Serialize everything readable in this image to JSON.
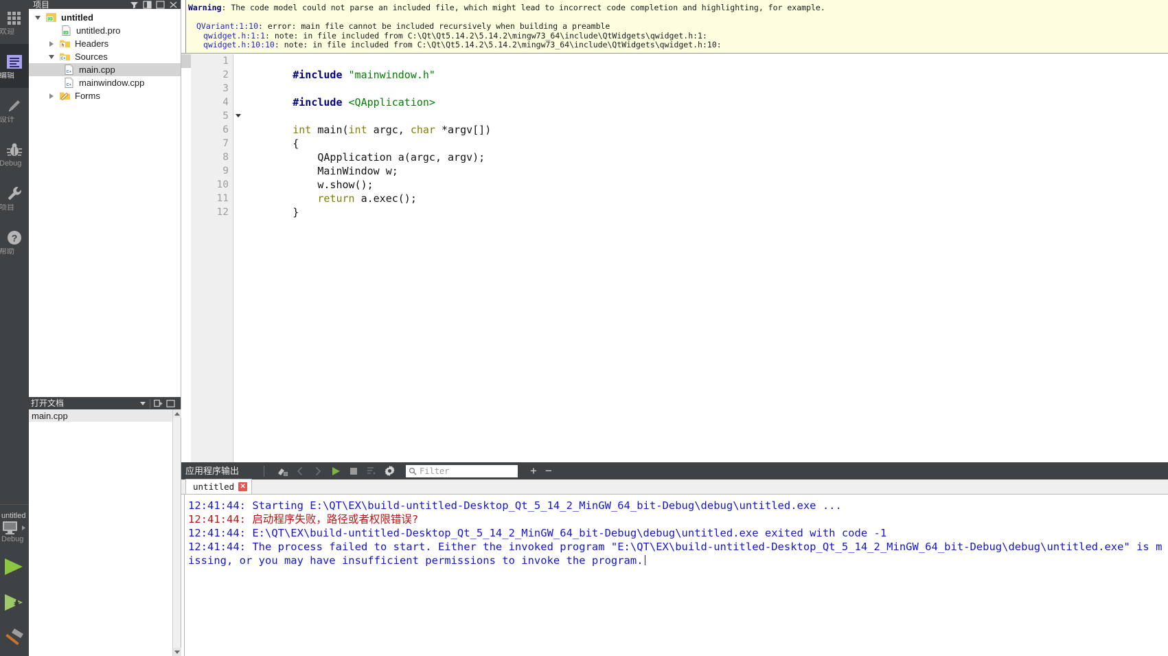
{
  "modebar": {
    "items": [
      {
        "id": "welcome",
        "label": "欢迎",
        "icon": "grid-icon",
        "active": false
      },
      {
        "id": "edit",
        "label": "编辑",
        "icon": "edit-lines-icon",
        "active": true
      },
      {
        "id": "design",
        "label": "设计",
        "icon": "pencil-icon",
        "active": false
      },
      {
        "id": "debug",
        "label": "Debug",
        "icon": "bug-icon",
        "active": false
      },
      {
        "id": "projects",
        "label": "项目",
        "icon": "wrench-icon",
        "active": false
      },
      {
        "id": "help",
        "label": "帮助",
        "icon": "question-mark-icon",
        "active": false
      }
    ],
    "kit": {
      "project": "untitled",
      "config": "Debug",
      "icon": "monitor-icon",
      "arrow": "chevron-right-icon"
    },
    "actions": [
      {
        "id": "run",
        "label": "Run",
        "icon": "run-triangle-icon"
      },
      {
        "id": "debug-run",
        "label": "Start Debugging",
        "icon": "run-debug-icon"
      },
      {
        "id": "build",
        "label": "Build",
        "icon": "hammer-icon"
      }
    ]
  },
  "project_panel": {
    "header_title": "项目",
    "tools": [
      "filter-icon",
      "split-icon",
      "maximize-icon",
      "close-icon"
    ],
    "tree": [
      {
        "label": "untitled",
        "icon": "qt-project-icon",
        "indent": 0,
        "expander": "down",
        "bold": true,
        "selected": false
      },
      {
        "label": "untitled.pro",
        "icon": "qt-pro-file-icon",
        "indent": 1,
        "expander": "none",
        "bold": false,
        "selected": false
      },
      {
        "label": "Headers",
        "icon": "headers-folder-icon",
        "indent": 1,
        "expander": "right",
        "bold": false,
        "selected": false
      },
      {
        "label": "Sources",
        "icon": "sources-folder-icon",
        "indent": 1,
        "expander": "down",
        "bold": false,
        "selected": false
      },
      {
        "label": "main.cpp",
        "icon": "cpp-file-icon",
        "indent": 2,
        "expander": "none",
        "bold": false,
        "selected": true
      },
      {
        "label": "mainwindow.cpp",
        "icon": "cpp-file-icon",
        "indent": 2,
        "expander": "none",
        "bold": false,
        "selected": false
      },
      {
        "label": "Forms",
        "icon": "forms-folder-icon",
        "indent": 1,
        "expander": "right",
        "bold": false,
        "selected": false
      }
    ]
  },
  "open_documents": {
    "header_title": "打开文档",
    "tools": [
      "split-icon",
      "close-icon"
    ],
    "items": [
      {
        "label": "main.cpp",
        "selected": true
      }
    ]
  },
  "warning_banner": {
    "lines": [
      {
        "indent": 0,
        "parts": [
          {
            "text": "Warning",
            "style": "kw"
          },
          {
            "text": ": The code model could not parse an included file, which might lead to incorrect code completion and highlighting, for example.",
            "style": "plain"
          }
        ]
      },
      {
        "indent": 0,
        "parts": [
          {
            "text": "",
            "style": "plain"
          }
        ]
      },
      {
        "indent": 1,
        "parts": [
          {
            "text": "QVariant:1:10",
            "style": "lnk"
          },
          {
            "text": ": error: main file cannot be included recursively when building a preamble",
            "style": "plain"
          }
        ]
      },
      {
        "indent": 2,
        "parts": [
          {
            "text": "qwidget.h:1:1",
            "style": "lnk"
          },
          {
            "text": ": note: in file included from C:\\Qt\\Qt5.14.2\\5.14.2\\mingw73_64\\include\\QtWidgets\\qwidget.h:1:",
            "style": "plain"
          }
        ]
      },
      {
        "indent": 2,
        "parts": [
          {
            "text": "qwidget.h:10:10",
            "style": "lnk"
          },
          {
            "text": ": note: in file included from C:\\Qt\\Qt5.14.2\\5.14.2\\mingw73_64\\include\\QtWidgets\\qwidget.h:10:",
            "style": "plain"
          }
        ]
      }
    ]
  },
  "editor": {
    "filename": "main.cpp",
    "line_count": 12,
    "fold_line": 5,
    "lines": [
      {
        "n": 1,
        "tokens": [
          {
            "t": "#include ",
            "c": "pp"
          },
          {
            "t": "\"mainwindow.h\"",
            "c": "str"
          }
        ]
      },
      {
        "n": 2,
        "tokens": []
      },
      {
        "n": 3,
        "tokens": [
          {
            "t": "#include ",
            "c": "pp"
          },
          {
            "t": "<QApplication>",
            "c": "inc"
          }
        ]
      },
      {
        "n": 4,
        "tokens": []
      },
      {
        "n": 5,
        "tokens": [
          {
            "t": "int",
            "c": "type"
          },
          {
            "t": " main(",
            "c": "plain"
          },
          {
            "t": "int",
            "c": "type"
          },
          {
            "t": " argc, ",
            "c": "plain"
          },
          {
            "t": "char",
            "c": "type"
          },
          {
            "t": " *argv[])",
            "c": "plain"
          }
        ]
      },
      {
        "n": 6,
        "tokens": [
          {
            "t": "{",
            "c": "plain"
          }
        ]
      },
      {
        "n": 7,
        "tokens": [
          {
            "t": "    QApplication a(argc, argv);",
            "c": "plain"
          }
        ]
      },
      {
        "n": 8,
        "tokens": [
          {
            "t": "    MainWindow w;",
            "c": "plain"
          }
        ]
      },
      {
        "n": 9,
        "tokens": [
          {
            "t": "    w.show();",
            "c": "plain"
          }
        ]
      },
      {
        "n": 10,
        "tokens": [
          {
            "t": "    ",
            "c": "plain"
          },
          {
            "t": "return",
            "c": "kw"
          },
          {
            "t": " a.exec();",
            "c": "plain"
          }
        ]
      },
      {
        "n": 11,
        "tokens": [
          {
            "t": "}",
            "c": "plain"
          }
        ]
      },
      {
        "n": 12,
        "tokens": []
      }
    ]
  },
  "output_pane": {
    "title": "应用程序输出",
    "toolbar_buttons": [
      {
        "id": "attach",
        "icon": "attach-debugger-icon"
      },
      {
        "id": "prev",
        "icon": "chevron-left-icon"
      },
      {
        "id": "next",
        "icon": "chevron-right-icon"
      },
      {
        "id": "rerun",
        "icon": "run-triangle-icon"
      },
      {
        "id": "stop",
        "icon": "stop-square-icon"
      },
      {
        "id": "zoom-reset",
        "icon": "text-wrap-icon"
      },
      {
        "id": "settings",
        "icon": "gear-icon"
      }
    ],
    "filter": {
      "value": "",
      "placeholder": "Filter",
      "icon": "search-icon"
    },
    "plus_label": "+",
    "minus_label": "−",
    "tabs": [
      {
        "label": "untitled",
        "close_label": "✕",
        "active": true
      }
    ],
    "lines": [
      {
        "type": "info",
        "text": "12:41:44: Starting E:\\QT\\EX\\build-untitled-Desktop_Qt_5_14_2_MinGW_64_bit-Debug\\debug\\untitled.exe ..."
      },
      {
        "type": "error",
        "text": "12:41:44: 启动程序失败，路径或者权限错误?"
      },
      {
        "type": "info",
        "text": "12:41:44: E:\\QT\\EX\\build-untitled-Desktop_Qt_5_14_2_MinGW_64_bit-Debug\\debug\\untitled.exe exited with code -1"
      },
      {
        "type": "info",
        "text": "12:41:44: The process failed to start. Either the invoked program \"E:\\QT\\EX\\build-untitled-Desktop_Qt_5_14_2_MinGW_64_bit-Debug\\debug\\untitled.exe\" is missing, or you may have insufficient permissions to invoke the program.",
        "caret": true
      }
    ]
  },
  "colors": {
    "chrome_dark": "#3f4244",
    "chrome_dark_active": "#2e3133",
    "warning_bg": "#fdfddf",
    "editor_bg": "#ffffff",
    "gutter_bg": "#efefef",
    "output_info": "#1515cc",
    "output_error": "#bb1111",
    "selection": "#d4d4d4",
    "accent_green": "#8cc63f",
    "close_red": "#e8554d"
  }
}
